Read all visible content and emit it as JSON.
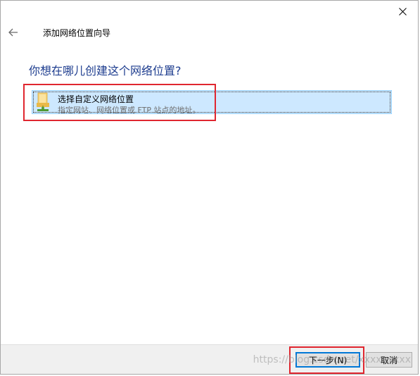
{
  "wizard": {
    "title": "添加网络位置向导",
    "question": "你想在哪儿创建这个网络位置?"
  },
  "option": {
    "title": "选择自定义网络位置",
    "description": "指定网站、网络位置或 FTP 站点的地址。",
    "icon": "folder-network-icon"
  },
  "footer": {
    "next_label": "下一步(N)",
    "cancel_label": "取消"
  },
  "watermark": "https://blog.csdn.net/xxxxxxxxx",
  "colors": {
    "accent": "#0078d7",
    "question_text": "#1e3d8f",
    "selection_bg": "#cde8ff",
    "selection_border": "#99d1ff",
    "annotation_red": "#e0262f",
    "footer_bg": "#f0f0f0"
  }
}
